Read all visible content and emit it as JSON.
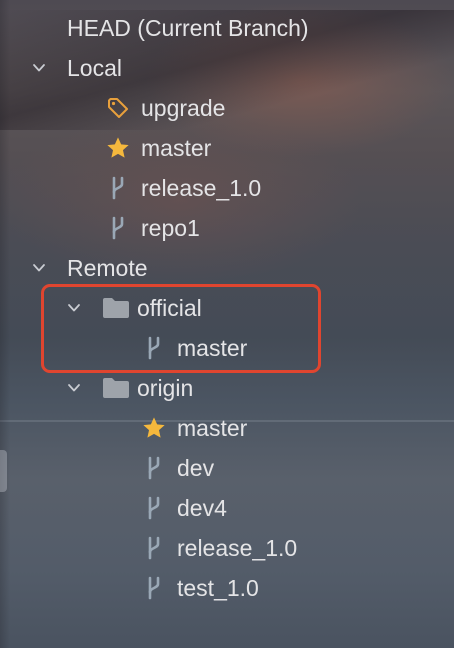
{
  "tree": {
    "head": {
      "label": "HEAD (Current Branch)"
    },
    "local": {
      "label": "Local",
      "items": [
        {
          "label": "upgrade",
          "icon": "tag-icon"
        },
        {
          "label": "master",
          "icon": "star-icon"
        },
        {
          "label": "release_1.0",
          "icon": "branch-icon"
        },
        {
          "label": "repo1",
          "icon": "branch-icon"
        }
      ]
    },
    "remote": {
      "label": "Remote",
      "groups": [
        {
          "label": "official",
          "icon": "folder-icon",
          "items": [
            {
              "label": "master",
              "icon": "branch-icon"
            }
          ]
        },
        {
          "label": "origin",
          "icon": "folder-icon",
          "items": [
            {
              "label": "master",
              "icon": "star-icon"
            },
            {
              "label": "dev",
              "icon": "branch-icon"
            },
            {
              "label": "dev4",
              "icon": "branch-icon"
            },
            {
              "label": "release_1.0",
              "icon": "branch-icon"
            },
            {
              "label": "test_1.0",
              "icon": "branch-icon"
            }
          ]
        }
      ]
    }
  },
  "colors": {
    "star": "#f5b83d",
    "tag": "#e8a03c",
    "branch": "#9aa8b6",
    "folder": "#9ea3aa",
    "highlight": "#e0452f"
  }
}
